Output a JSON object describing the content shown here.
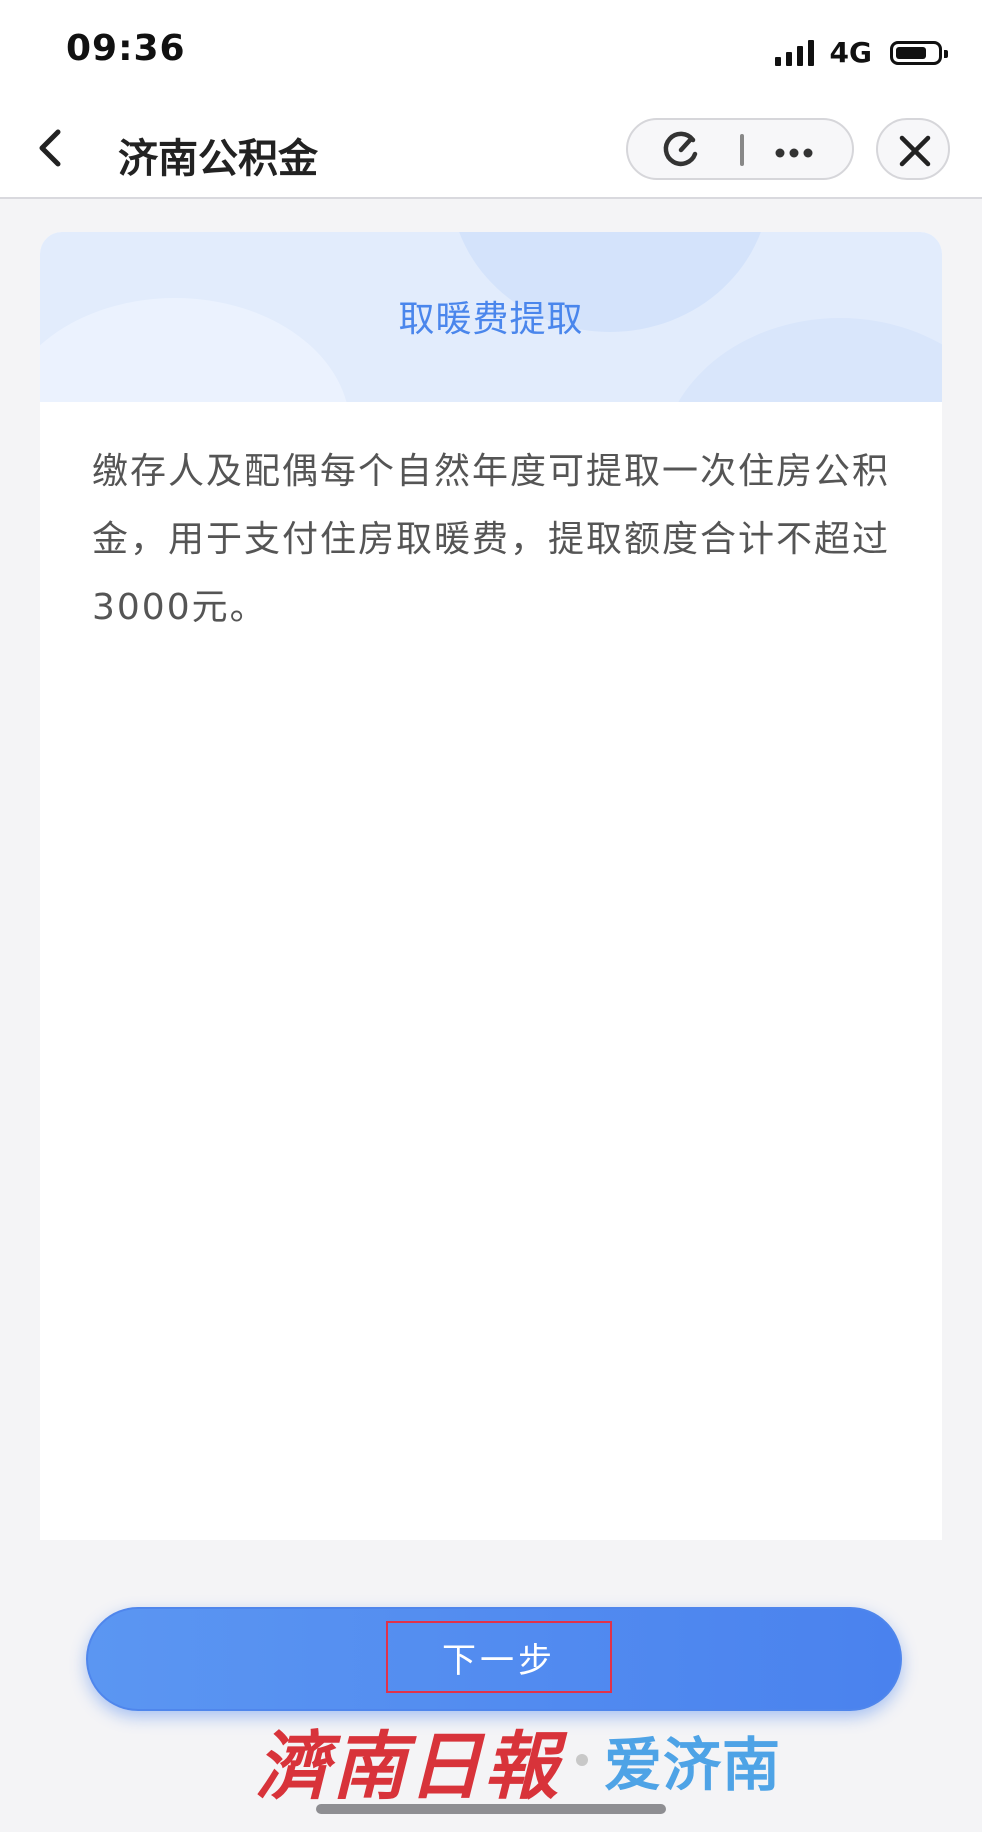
{
  "status_bar": {
    "time": "09:36",
    "network": "4G"
  },
  "nav": {
    "title": "济南公积金"
  },
  "card": {
    "title": "取暖费提取",
    "body": "缴存人及配偶每个自然年度可提取一次住房公积金，用于支付住房取暖费，提取额度合计不超过3000元。"
  },
  "actions": {
    "next_label": "下一步"
  },
  "watermark": {
    "left": "濟南日報",
    "right": "爱济南"
  },
  "colors": {
    "accent": "#4a86ec",
    "button": "#4a82ee",
    "watermark_red": "#d8333a",
    "watermark_blue": "#4ea3e6"
  }
}
